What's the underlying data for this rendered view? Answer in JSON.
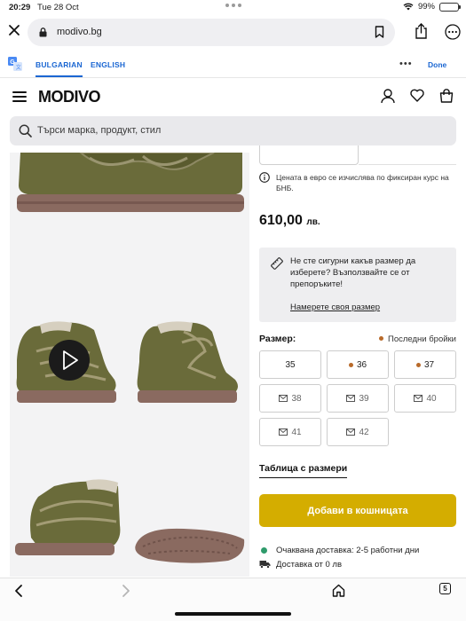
{
  "status": {
    "time": "20:29",
    "date": "Tue 28 Oct",
    "battery": "99%"
  },
  "browser": {
    "url": "modivo.bg",
    "tab_count": "5"
  },
  "translate": {
    "lang_active": "BULGARIAN",
    "lang_other": "ENGLISH",
    "done": "Done"
  },
  "site": {
    "logo": "MODIVO",
    "search_placeholder": "Търси марка, продукт, стил"
  },
  "product": {
    "euro_note": "Цената в евро се изчислява по фиксиран курс на БНБ.",
    "price": "610,00",
    "currency": "лв.",
    "size_help_text": "Не сте сигурни какъв размер да изберете? Възползвайте се от препоръките!",
    "size_help_link": "Намерете своя размер",
    "size_label": "Размер:",
    "last_items_label": "Последни бройки",
    "sizes": [
      {
        "label": "35",
        "state": "available"
      },
      {
        "label": "36",
        "state": "last"
      },
      {
        "label": "37",
        "state": "last"
      },
      {
        "label": "38",
        "state": "notify"
      },
      {
        "label": "39",
        "state": "notify"
      },
      {
        "label": "40",
        "state": "notify"
      },
      {
        "label": "41",
        "state": "notify"
      },
      {
        "label": "42",
        "state": "notify"
      }
    ],
    "size_table_link": "Таблица с размери",
    "add_to_cart": "Добави в кошницата",
    "delivery_text": "Очаквана доставка: 2-5 работни дни",
    "shipping_text": "Доставка от 0 лв"
  },
  "colors": {
    "accent_yellow": "#d4ad00",
    "last_items_dot": "#b86a2a",
    "delivery_dot": "#2e9b6b",
    "link_blue": "#1a66d2"
  }
}
